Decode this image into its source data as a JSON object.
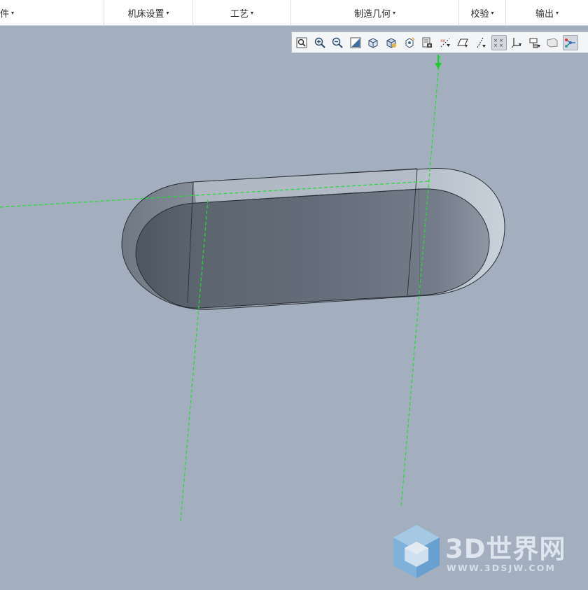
{
  "menubar": {
    "groups": [
      {
        "label": "件",
        "caret": "▾"
      },
      {
        "label": "机床设置",
        "caret": "▾"
      },
      {
        "label": "工艺",
        "caret": "▾"
      },
      {
        "label": "制造几何",
        "caret": "▾"
      },
      {
        "label": "校验",
        "caret": "▾"
      },
      {
        "label": "输出",
        "caret": "▾"
      }
    ]
  },
  "toolbar": {
    "buttons": [
      {
        "icon": "refit-icon",
        "active": false
      },
      {
        "icon": "zoom-in-icon",
        "active": false
      },
      {
        "icon": "zoom-out-icon",
        "active": false
      },
      {
        "icon": "repaint-icon",
        "active": false
      },
      {
        "icon": "display-style-icon",
        "active": false
      },
      {
        "icon": "standard-orientation-icon",
        "active": false
      },
      {
        "icon": "spin-center-icon",
        "active": false
      },
      {
        "icon": "saved-views-icon",
        "active": false
      },
      {
        "icon": "datum-display-filter-icon",
        "active": false
      },
      {
        "icon": "plane-display-icon",
        "active": false
      },
      {
        "icon": "axis-display-icon",
        "active": false
      },
      {
        "icon": "point-display-icon",
        "active": true
      },
      {
        "icon": "csys-display-icon",
        "active": false
      },
      {
        "icon": "annotation-display-icon",
        "active": false
      },
      {
        "icon": "perspective-view-icon",
        "active": false
      },
      {
        "icon": "toolpath-display-icon",
        "active": true
      }
    ]
  },
  "watermark": {
    "brand": "3D世界网",
    "url": "WWW.3DSJW.COM"
  },
  "colors": {
    "viewport_background": "#a3afbe",
    "datum_axis": "#22dd33",
    "pocket_floor": "#606a76",
    "part_top": "#b8c1cd"
  }
}
